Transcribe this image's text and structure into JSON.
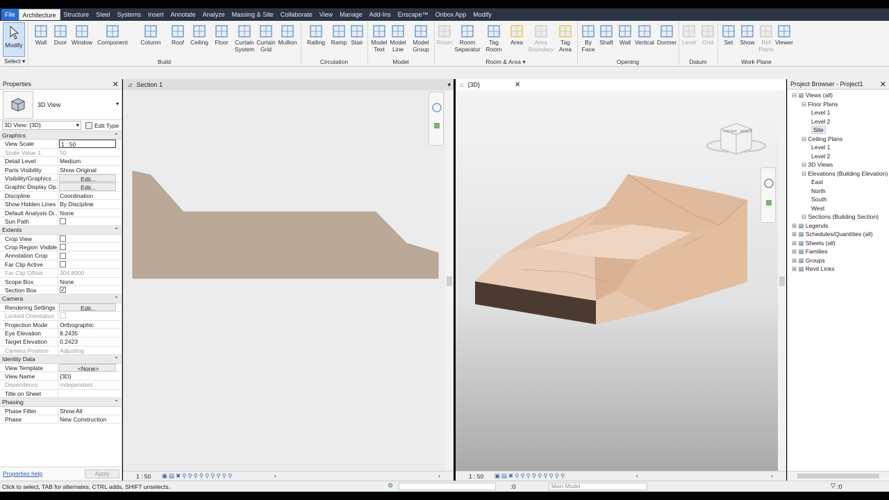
{
  "tabs": [
    "File",
    "Architecture",
    "Structure",
    "Steel",
    "Systems",
    "Insert",
    "Annotate",
    "Analyze",
    "Massing & Site",
    "Collaborate",
    "View",
    "Manage",
    "Add-Ins",
    "Enscape™",
    "Onbox App",
    "Modify"
  ],
  "ribbon": {
    "modify": "Modify",
    "select": "Select",
    "build": [
      {
        "l1": "Wall",
        "l2": ""
      },
      {
        "l1": "Door",
        "l2": ""
      },
      {
        "l1": "Window",
        "l2": ""
      },
      {
        "l1": "Component",
        "l2": ""
      },
      {
        "l1": "Column",
        "l2": ""
      },
      {
        "l1": "Roof",
        "l2": ""
      },
      {
        "l1": "Ceiling",
        "l2": ""
      },
      {
        "l1": "Floor",
        "l2": ""
      },
      {
        "l1": "Curtain",
        "l2": "System"
      },
      {
        "l1": "Curtain",
        "l2": "Grid"
      },
      {
        "l1": "Mullion",
        "l2": ""
      }
    ],
    "circulation": [
      {
        "l1": "Railing",
        "l2": ""
      },
      {
        "l1": "Ramp",
        "l2": ""
      },
      {
        "l1": "Stair",
        "l2": ""
      }
    ],
    "model": [
      {
        "l1": "Model",
        "l2": "Text"
      },
      {
        "l1": "Model",
        "l2": "Line"
      },
      {
        "l1": "Model",
        "l2": "Group"
      }
    ],
    "room": [
      {
        "l1": "Room",
        "l2": ""
      },
      {
        "l1": "Room",
        "l2": "Separator"
      },
      {
        "l1": "Tag",
        "l2": "Room"
      },
      {
        "l1": "Area",
        "l2": ""
      },
      {
        "l1": "Area",
        "l2": "Boundary"
      },
      {
        "l1": "Tag",
        "l2": "Area"
      }
    ],
    "opening": [
      {
        "l1": "By",
        "l2": "Face"
      },
      {
        "l1": "Shaft",
        "l2": ""
      },
      {
        "l1": "Wall",
        "l2": ""
      },
      {
        "l1": "Vertical",
        "l2": ""
      },
      {
        "l1": "Dormer",
        "l2": ""
      }
    ],
    "datum": [
      {
        "l1": "Level",
        "l2": ""
      },
      {
        "l1": "Grid",
        "l2": ""
      }
    ],
    "workplane": [
      {
        "l1": "Set",
        "l2": ""
      },
      {
        "l1": "Show",
        "l2": ""
      },
      {
        "l1": "Ref",
        "l2": "Plane"
      },
      {
        "l1": "Viewer",
        "l2": ""
      }
    ],
    "panels": {
      "build": "Build",
      "circulation": "Circulation",
      "model": "Model",
      "room": "Room & Area",
      "opening": "Opening",
      "datum": "Datum",
      "workplane": "Work Plane"
    }
  },
  "properties": {
    "title": "Properties",
    "type_name": "3D View",
    "selector": "3D View: {3D}",
    "edit_type": "Edit Type",
    "groups": [
      {
        "name": "Graphics",
        "rows": [
          {
            "k": "View Scale",
            "v": "1 : 50",
            "kind": "input"
          },
          {
            "k": "Scale Value    1:",
            "v": "50",
            "kind": "ro"
          },
          {
            "k": "Detail Level",
            "v": "Medium"
          },
          {
            "k": "Parts Visibility",
            "v": "Show Original"
          },
          {
            "k": "Visibility/Graphics ...",
            "v": "Edit...",
            "kind": "btn"
          },
          {
            "k": "Graphic Display Op...",
            "v": "Edit...",
            "kind": "btn"
          },
          {
            "k": "Discipline",
            "v": "Coordination"
          },
          {
            "k": "Show Hidden Lines",
            "v": "By Discipline"
          },
          {
            "k": "Default Analysis Di...",
            "v": "None"
          },
          {
            "k": "Sun Path",
            "v": "",
            "kind": "chk"
          }
        ]
      },
      {
        "name": "Extents",
        "rows": [
          {
            "k": "Crop View",
            "v": "",
            "kind": "chk"
          },
          {
            "k": "Crop Region Visible",
            "v": "",
            "kind": "chk"
          },
          {
            "k": "Annotation Crop",
            "v": "",
            "kind": "chk"
          },
          {
            "k": "Far Clip Active",
            "v": "",
            "kind": "chk"
          },
          {
            "k": "Far Clip Offset",
            "v": "304.8000",
            "kind": "ro"
          },
          {
            "k": "Scope Box",
            "v": "None"
          },
          {
            "k": "Section Box",
            "v": "",
            "kind": "chkon"
          }
        ]
      },
      {
        "name": "Camera",
        "rows": [
          {
            "k": "Rendering Settings",
            "v": "Edit...",
            "kind": "btn"
          },
          {
            "k": "Locked Orientation",
            "v": "",
            "kind": "rochk"
          },
          {
            "k": "Projection Mode",
            "v": "Orthographic"
          },
          {
            "k": "Eye Elevation",
            "v": "8.2435"
          },
          {
            "k": "Target Elevation",
            "v": "0.2423"
          },
          {
            "k": "Camera Position",
            "v": "Adjusting",
            "kind": "ro"
          }
        ]
      },
      {
        "name": "Identity Data",
        "rows": [
          {
            "k": "View Template",
            "v": "<None>",
            "kind": "btn"
          },
          {
            "k": "View Name",
            "v": "{3D}"
          },
          {
            "k": "Dependency",
            "v": "Independent",
            "kind": "ro"
          },
          {
            "k": "Title on Sheet",
            "v": ""
          }
        ]
      },
      {
        "name": "Phasing",
        "rows": [
          {
            "k": "Phase Filter",
            "v": "Show All"
          },
          {
            "k": "Phase",
            "v": "New Construction"
          }
        ]
      }
    ],
    "help": "Properties help",
    "apply": "Apply"
  },
  "views": {
    "section_tab": "Section 1",
    "view3d_tab": "{3D}",
    "scale_left": "1 : 50",
    "scale_right": "1 : 50"
  },
  "viewcube": {
    "front": "FRONT",
    "right": "RIGHT"
  },
  "browser": {
    "title": "Project Browser - Project1",
    "items": [
      {
        "t": "Views (all)",
        "lvl": 0
      },
      {
        "t": "Floor Plans",
        "lvl": 1
      },
      {
        "t": "Level 1",
        "lvl": 2
      },
      {
        "t": "Level 2",
        "lvl": 2
      },
      {
        "t": "Site",
        "lvl": 2,
        "sel": true
      },
      {
        "t": "Ceiling Plans",
        "lvl": 1
      },
      {
        "t": "Level 1",
        "lvl": 2
      },
      {
        "t": "Level 2",
        "lvl": 2
      },
      {
        "t": "3D Views",
        "lvl": 1
      },
      {
        "t": "Elevations (Building Elevation)",
        "lvl": 1
      },
      {
        "t": "East",
        "lvl": 2
      },
      {
        "t": "North",
        "lvl": 2
      },
      {
        "t": "South",
        "lvl": 2
      },
      {
        "t": "West",
        "lvl": 2
      },
      {
        "t": "Sections (Building Section)",
        "lvl": 1
      },
      {
        "t": "Legends",
        "lvl": 0
      },
      {
        "t": "Schedules/Quantities (all)",
        "lvl": 0
      },
      {
        "t": "Sheets (all)",
        "lvl": 0
      },
      {
        "t": "Families",
        "lvl": 0
      },
      {
        "t": "Groups",
        "lvl": 0
      },
      {
        "t": "Revit Links",
        "lvl": 0
      }
    ]
  },
  "status": {
    "message": "Click to select, TAB for alternates, CTRL adds, SHIFT unselects.",
    "counter": ":0",
    "model": "Main Model",
    "filter": ":0"
  },
  "colors": {
    "accent": "#2a6fd1",
    "terrain": "#e8c9b2",
    "soil": "#4a3a30",
    "section_fill": "#bba998"
  }
}
